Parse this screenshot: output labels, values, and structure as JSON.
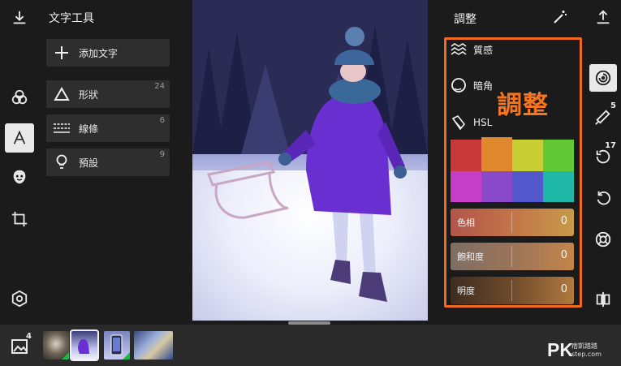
{
  "left_rail": {
    "items": [
      "download-icon",
      "filters-icon",
      "text-tool-icon",
      "sticker-icon",
      "crop-icon",
      "settings-icon"
    ]
  },
  "tool_panel": {
    "title": "文字工具",
    "items": [
      {
        "label": "添加文字",
        "count": "",
        "icon": "plus-icon"
      },
      {
        "label": "形狀",
        "count": "24",
        "icon": "triangle-icon"
      },
      {
        "label": "線條",
        "count": "6",
        "icon": "lines-icon"
      },
      {
        "label": "預設",
        "count": "9",
        "icon": "bulb-icon"
      }
    ]
  },
  "adjust_panel": {
    "title": "調整",
    "overlay_label": "調整",
    "items": [
      {
        "label": "質感",
        "icon": "texture-icon"
      },
      {
        "label": "暗角",
        "icon": "vignette-icon"
      },
      {
        "label": "HSL",
        "icon": "hsl-icon"
      }
    ],
    "swatches": [
      "#c83a3a",
      "#e0882e",
      "#c7cf34",
      "#62c835",
      "#c53ec8",
      "#8a49c9",
      "#5458cd",
      "#1fb7a8"
    ],
    "selected_swatch_index": 1,
    "sliders": [
      {
        "label": "色相",
        "value": "0"
      },
      {
        "label": "飽和度",
        "value": "0"
      },
      {
        "label": "明度",
        "value": "0"
      }
    ],
    "accent": "#f06a1f"
  },
  "right_rail": {
    "badges": {
      "heal": "5",
      "history": "17"
    }
  },
  "bottom": {
    "layers_badge": "4",
    "brand_logo": "PK",
    "brand_name": "痞凱踏踏",
    "brand_url": "step.com"
  }
}
